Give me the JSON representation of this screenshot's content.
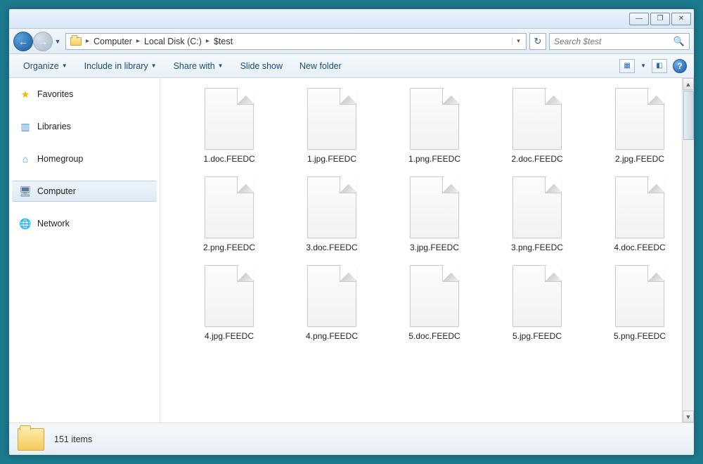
{
  "titlebar": {
    "min": "—",
    "max": "❐",
    "close": "✕"
  },
  "breadcrumb": {
    "segments": [
      "Computer",
      "Local Disk (C:)",
      "$test"
    ]
  },
  "search": {
    "placeholder": "Search $test"
  },
  "toolbar": {
    "organize": "Organize",
    "include": "Include in library",
    "share": "Share with",
    "slideshow": "Slide show",
    "newfolder": "New folder"
  },
  "sidebar": {
    "items": [
      {
        "label": "Favorites",
        "icon": "star"
      },
      {
        "label": "Libraries",
        "icon": "libraries"
      },
      {
        "label": "Homegroup",
        "icon": "homegroup"
      },
      {
        "label": "Computer",
        "icon": "computer"
      },
      {
        "label": "Network",
        "icon": "network"
      }
    ],
    "selected": 3
  },
  "files": [
    "1.doc.FEEDC",
    "1.jpg.FEEDC",
    "1.png.FEEDC",
    "2.doc.FEEDC",
    "2.jpg.FEEDC",
    "2.png.FEEDC",
    "3.doc.FEEDC",
    "3.jpg.FEEDC",
    "3.png.FEEDC",
    "4.doc.FEEDC",
    "4.jpg.FEEDC",
    "4.png.FEEDC",
    "5.doc.FEEDC",
    "5.jpg.FEEDC",
    "5.png.FEEDC"
  ],
  "status": {
    "count": "151 items"
  }
}
